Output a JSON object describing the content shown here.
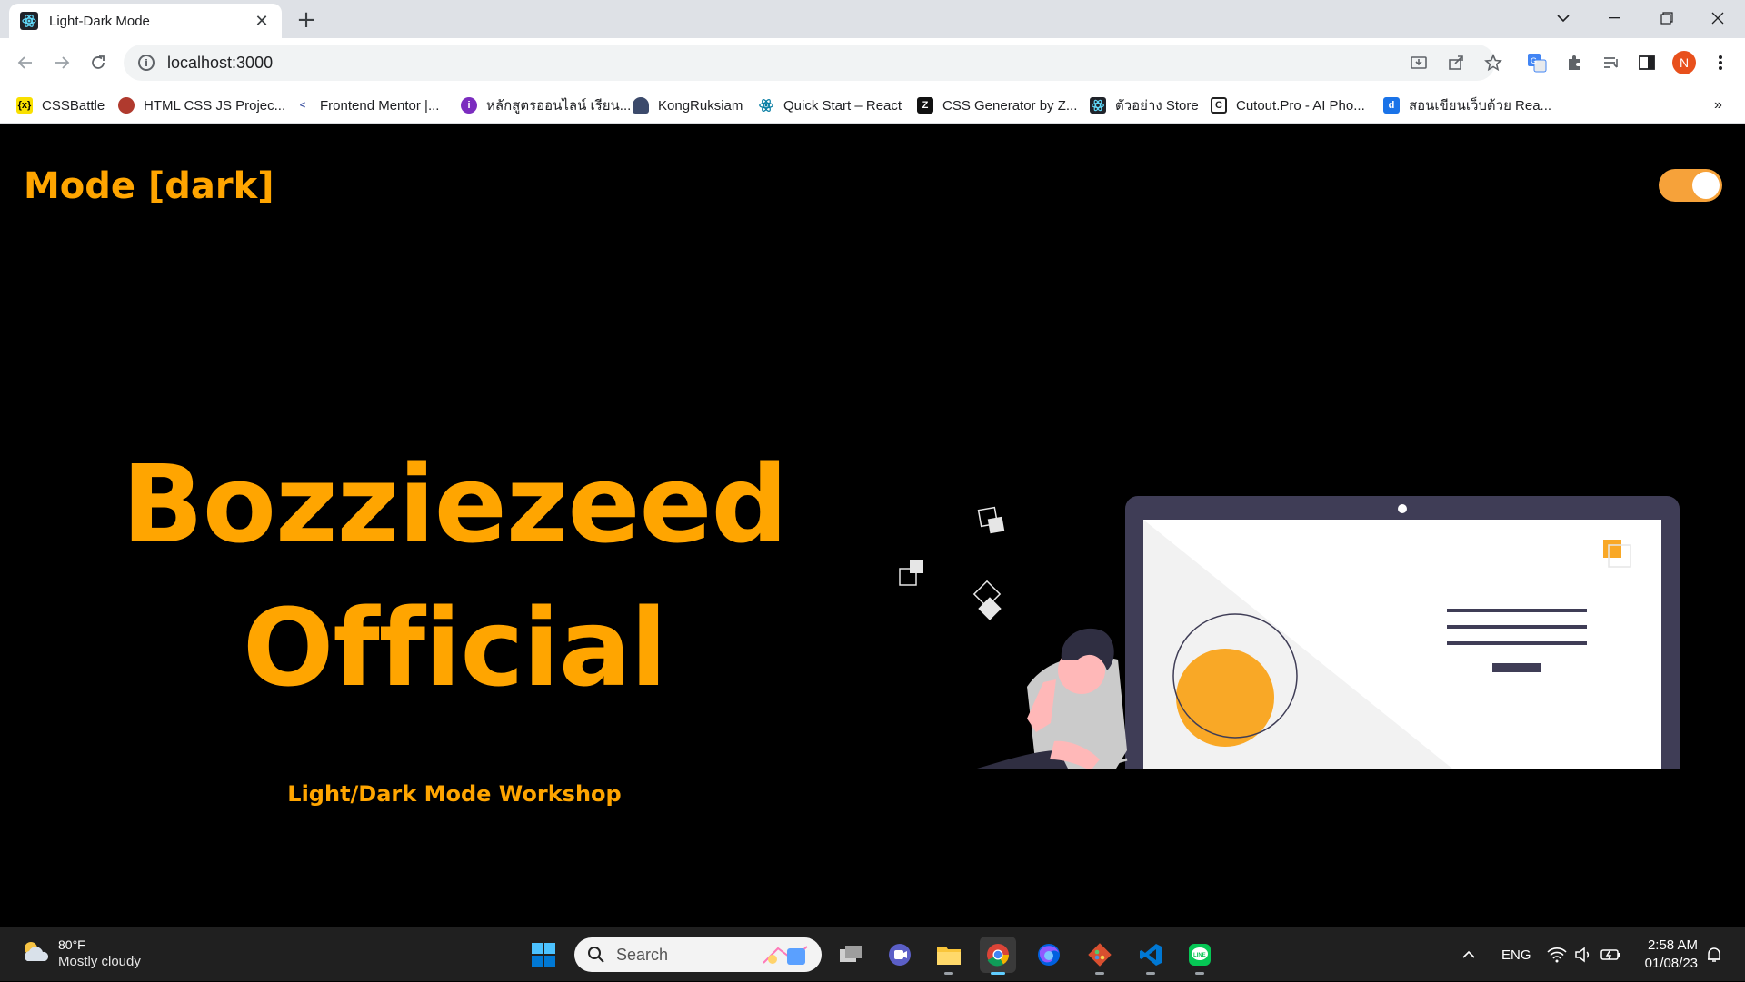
{
  "browser": {
    "tab_title": "Light-Dark Mode",
    "tab_close": "✕",
    "new_tab": "+",
    "url": "localhost:3000",
    "profile_initial": "N",
    "bookmarks_overflow": "»"
  },
  "bookmarks": [
    {
      "label": "CSSBattle",
      "icon": "cssbattle-icon",
      "color": "#f9e000"
    },
    {
      "label": "HTML CSS JS Projec...",
      "icon": "html-project-icon",
      "color": "#b03a2e"
    },
    {
      "label": "Frontend Mentor |...",
      "icon": "frontend-mentor-icon",
      "color": "#ffffff"
    },
    {
      "label": "หลักสูตรออนไลน์ เรียน...",
      "icon": "course-icon",
      "color": "#7b2cbf"
    },
    {
      "label": "KongRuksiam",
      "icon": "kongruksiam-icon",
      "color": "#3c4a6b"
    },
    {
      "label": "Quick Start – React",
      "icon": "react-icon",
      "color": "#087ea4"
    },
    {
      "label": "CSS Generator by Z...",
      "icon": "css-generator-icon",
      "color": "#111111"
    },
    {
      "label": "ตัวอย่าง Store",
      "icon": "react-icon",
      "color": "#20232a"
    },
    {
      "label": "Cutout.Pro - AI Pho...",
      "icon": "cutout-icon",
      "color": "#222222"
    },
    {
      "label": "สอนเขียนเว็บด้วย Rea...",
      "icon": "tutorial-icon",
      "color": "#1a73e8"
    }
  ],
  "page": {
    "mode_title": "Mode [dark]",
    "hero_line1": "Bozziezeed",
    "hero_line2": "Official",
    "subtitle": "Light/Dark Mode Workshop",
    "toggle_on": true,
    "accent_color": "#ffa500"
  },
  "taskbar": {
    "temperature": "80°F",
    "condition": "Mostly cloudy",
    "search_placeholder": "Search",
    "language": "ENG",
    "time": "2:58 AM",
    "date": "01/08/23",
    "apps": [
      "start-icon",
      "task-view-icon",
      "teams-icon",
      "file-explorer-icon",
      "chrome-icon",
      "firefox-icon",
      "git-icon",
      "vscode-icon",
      "line-icon"
    ]
  }
}
